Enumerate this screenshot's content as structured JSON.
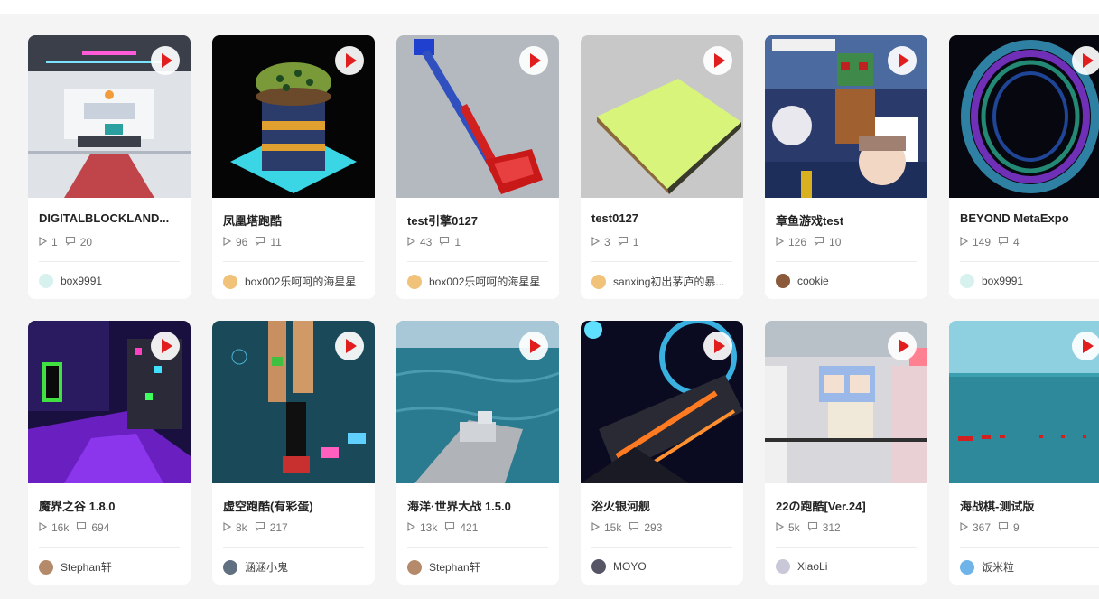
{
  "rows": [
    [
      {
        "title": "DIGITALBLOCKLAND...",
        "plays": "1",
        "comments": "20",
        "author": "box9991",
        "avatar_color": "#d7f2ee",
        "thumb": "hall"
      },
      {
        "title": "凤凰塔跑酷",
        "plays": "96",
        "comments": "11",
        "author": "box002乐呵呵的海星星",
        "avatar_color": "#f0c27a",
        "thumb": "tower"
      },
      {
        "title": "test引擎0127",
        "plays": "43",
        "comments": "1",
        "author": "box002乐呵呵的海星星",
        "avatar_color": "#f0c27a",
        "thumb": "shovel"
      },
      {
        "title": "test0127",
        "plays": "3",
        "comments": "1",
        "author": "sanxing初出茅庐的暴...",
        "avatar_color": "#f0c27a",
        "thumb": "plane"
      },
      {
        "title": "章鱼游戏test",
        "plays": "126",
        "comments": "10",
        "author": "cookie",
        "avatar_color": "#8a5a3a",
        "thumb": "squid"
      },
      {
        "title": "BEYOND MetaExpo",
        "plays": "149",
        "comments": "4",
        "author": "box9991",
        "avatar_color": "#d7f2ee",
        "thumb": "ring"
      }
    ],
    [
      {
        "title": "魔界之谷 1.8.0",
        "plays": "16k",
        "comments": "694",
        "author": "Stephan轩",
        "avatar_color": "#b58a6a",
        "thumb": "neon"
      },
      {
        "title": "虚空跑酷(有彩蛋)",
        "plays": "8k",
        "comments": "217",
        "author": "涵涵小鬼",
        "avatar_color": "#607080",
        "thumb": "void"
      },
      {
        "title": "海洋·世界大战 1.5.0",
        "plays": "13k",
        "comments": "421",
        "author": "Stephan轩",
        "avatar_color": "#b58a6a",
        "thumb": "ship"
      },
      {
        "title": "浴火银河舰",
        "plays": "15k",
        "comments": "293",
        "author": "MOYO",
        "avatar_color": "#555566",
        "thumb": "galaxy"
      },
      {
        "title": "22の跑酷[Ver.24]",
        "plays": "5k",
        "comments": "312",
        "author": "XiaoLi",
        "avatar_color": "#c8c8d8",
        "thumb": "anime"
      },
      {
        "title": "海战棋-测试版",
        "plays": "367",
        "comments": "9",
        "author": "饭米粒",
        "avatar_color": "#6fb4e8",
        "thumb": "sea"
      }
    ]
  ]
}
